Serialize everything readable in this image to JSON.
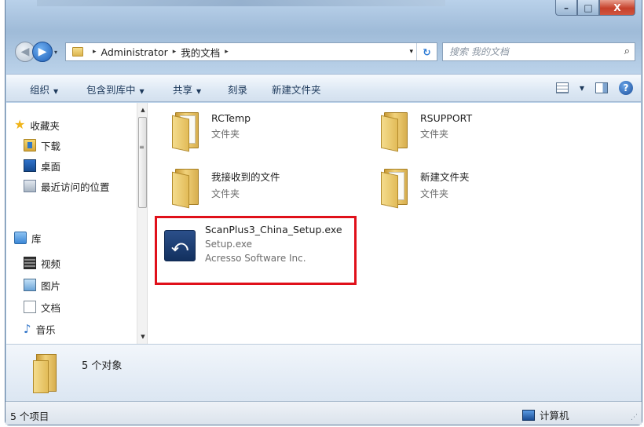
{
  "window": {
    "controls": {
      "minimize": "–",
      "maximize": "□",
      "close": "X"
    }
  },
  "nav": {
    "back_glyph": "◀",
    "forward_glyph": "▶",
    "recent_glyph": "▾",
    "breadcrumb": [
      "Administrator",
      "我的文档"
    ],
    "crumb_separator": "▸",
    "dropdown_glyph": "▾",
    "refresh_glyph": "↻",
    "search_placeholder": "搜索 我的文档",
    "search_icon": "⌕"
  },
  "toolbar": {
    "organize": "组织",
    "include_in_library": "包含到库中",
    "share": "共享",
    "burn": "刻录",
    "new_folder": "新建文件夹",
    "caret": "▼",
    "help": "?"
  },
  "sidebar": {
    "favorites": {
      "label": "收藏夹",
      "icon": "star-icon"
    },
    "fav_items": [
      {
        "label": "下载",
        "icon": "downloads-icon"
      },
      {
        "label": "桌面",
        "icon": "desktop-icon"
      },
      {
        "label": "最近访问的位置",
        "icon": "recent-places-icon"
      }
    ],
    "library": {
      "label": "库",
      "icon": "library-icon"
    },
    "lib_items": [
      {
        "label": "视频",
        "icon": "video-icon"
      },
      {
        "label": "图片",
        "icon": "pictures-icon"
      },
      {
        "label": "文档",
        "icon": "documents-icon"
      },
      {
        "label": "音乐",
        "icon": "music-icon"
      }
    ],
    "scroll_up": "▲",
    "scroll_down": "▼",
    "scroll_grip": "≡"
  },
  "files": [
    {
      "name": "RCTemp",
      "type": "文件夹"
    },
    {
      "name": "RSUPPORT",
      "type": "文件夹"
    },
    {
      "name": "我接收到的文件",
      "type": "文件夹"
    },
    {
      "name": "新建文件夹",
      "type": "文件夹"
    },
    {
      "name": "ScanPlus3_China_Setup.exe",
      "desc": "Setup.exe",
      "company": "Acresso Software Inc."
    }
  ],
  "highlight_color": "#e0101a",
  "details": {
    "count": "5 个对象"
  },
  "status": {
    "items": "5 个项目",
    "computer": "计算机",
    "grip": "⋰"
  }
}
